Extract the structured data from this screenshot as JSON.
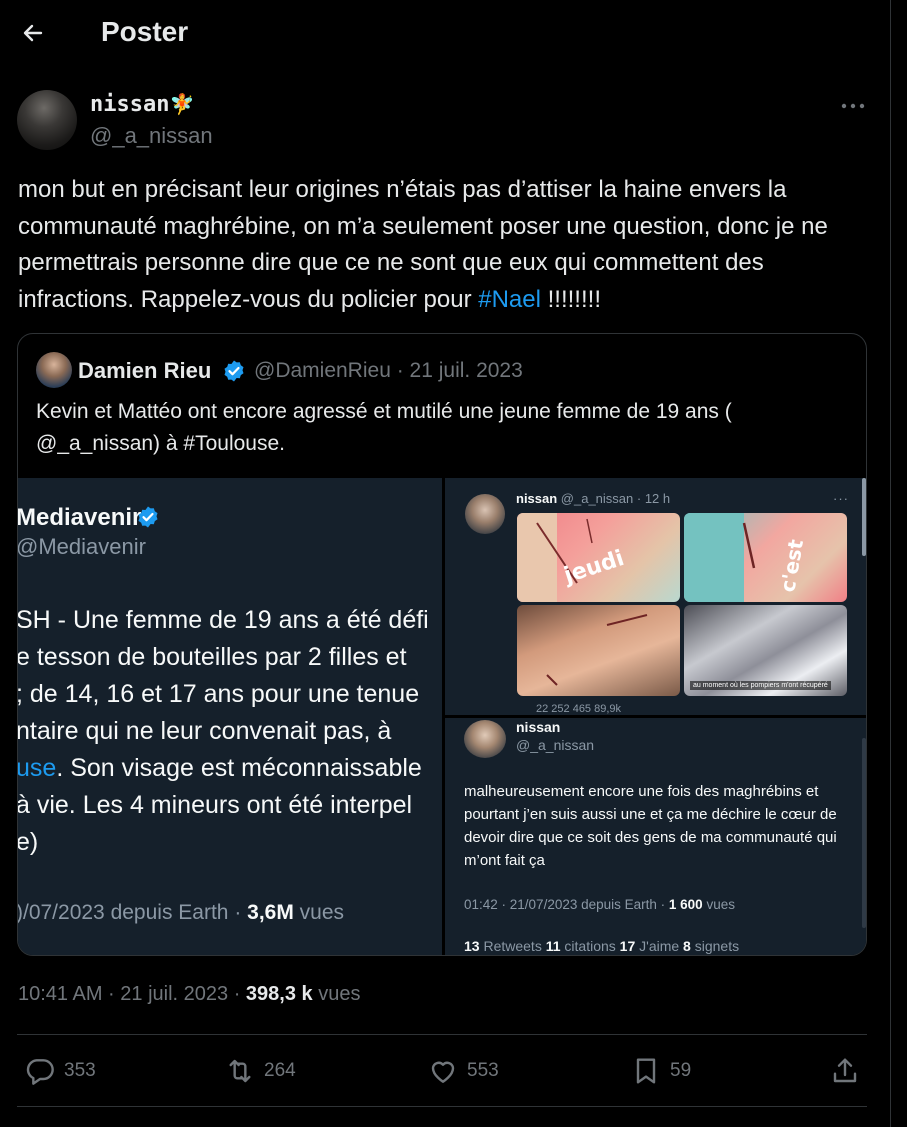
{
  "header": {
    "title": "Poster"
  },
  "author": {
    "name": "nissan",
    "emoji": "🧚",
    "handle": "@_a_nissan"
  },
  "tweet": {
    "text_before_hashtag": "mon but en précisant leur origines n’étais pas d’attiser la haine envers la communauté maghrébine, on m’a seulement poser une question, donc je ne permettrais personne dire que ce ne sont que eux qui commettent des infractions. Rappelez-vous du policier pour ",
    "hashtag": "#Nael",
    "text_after_hashtag": " !!!!!!!!"
  },
  "quote": {
    "author_name": "Damien Rieu",
    "meta": "@DamienRieu · 21 juil. 2023",
    "text": "Kevin et Mattéo ont encore agressé et mutilé une jeune femme de 19 ans ( @_a_nissan) à #Toulouse.",
    "left_panel": {
      "name": "Mediavenir",
      "handle": "@Mediavenir",
      "line1": "SH - Une femme de 19 ans a été défi",
      "line2": "e tesson de bouteilles par 2 filles et",
      "line3": "; de 14, 16 et 17 ans pour une tenue",
      "line4": "ntaire qui ne leur convenait pas, à",
      "line5_link": "use",
      "line5_rest": ". Son visage est méconnaissable",
      "line6": " à vie. Les 4 mineurs ont été interpel",
      "line7": "e)",
      "footer_prefix": ")/07/2023 depuis Earth · ",
      "footer_views": "3,6M",
      "footer_suffix": " vues"
    },
    "top_right_panel": {
      "name": "nissan",
      "meta": " @_a_nissan · 12 h",
      "dots": "···",
      "photo_label": "c'est jeudi",
      "caption": "au moment où les pompiers m'ont récupéré",
      "stats": "22       252       465       89,9k"
    },
    "bottom_right_panel": {
      "name": "nissan",
      "handle": "@_a_nissan",
      "text": "malheureusement encore une fois des maghrébins et pourtant j’en suis aussi une et ça me déchire le cœur de devoir dire que ce soit des gens de ma communauté qui m’ont fait ça",
      "time_prefix": "01:42 · 21/07/2023 depuis Earth · ",
      "views": "1 600",
      "views_suffix": " vues",
      "retweets": "13",
      "retweets_label": " Retweets  ",
      "quotes": "11",
      "quotes_label": " citations  ",
      "likes": "17",
      "likes_label": " J'aime  ",
      "bookmarks": "8",
      "bookmarks_label": " signets"
    }
  },
  "timestamp": {
    "time_date": "10:41 AM · 21 juil. 2023 · ",
    "views": "398,3 k",
    "views_label": " vues"
  },
  "actions": {
    "replies": "353",
    "retweets": "264",
    "likes": "553",
    "bookmarks": "59"
  },
  "colors": {
    "background": "#000000",
    "accent": "#1d9bf0",
    "text": "#e7e9ea",
    "muted": "#71767b",
    "border": "#2f3336"
  }
}
